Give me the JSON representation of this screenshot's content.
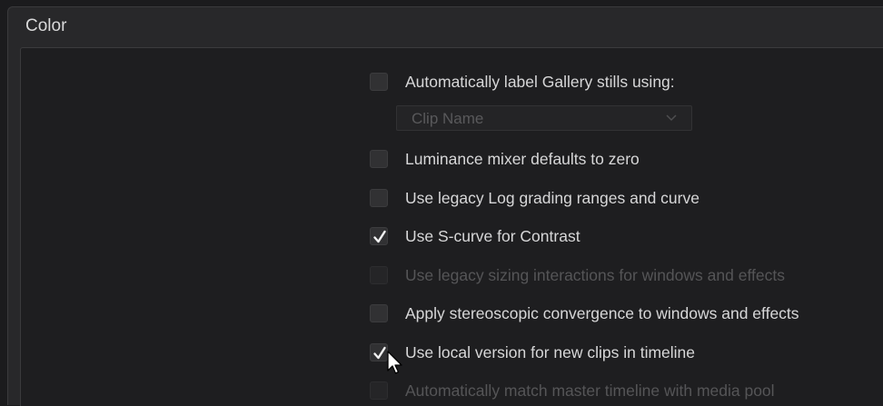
{
  "section": {
    "title": "Color"
  },
  "dropdown": {
    "value": "Clip Name"
  },
  "options": [
    {
      "label": "Automatically label Gallery stills using:",
      "checked": false,
      "enabled": true
    },
    {
      "label": "Luminance mixer defaults to zero",
      "checked": false,
      "enabled": true
    },
    {
      "label": "Use legacy Log grading ranges and curve",
      "checked": false,
      "enabled": true
    },
    {
      "label": "Use S-curve for Contrast",
      "checked": true,
      "enabled": true
    },
    {
      "label": "Use legacy sizing interactions for windows and effects",
      "checked": false,
      "enabled": false
    },
    {
      "label": "Apply stereoscopic convergence to windows and effects",
      "checked": false,
      "enabled": true
    },
    {
      "label": "Use local version for new clips in timeline",
      "checked": true,
      "enabled": true
    },
    {
      "label": "Automatically match master timeline with media pool",
      "checked": false,
      "enabled": false
    }
  ]
}
